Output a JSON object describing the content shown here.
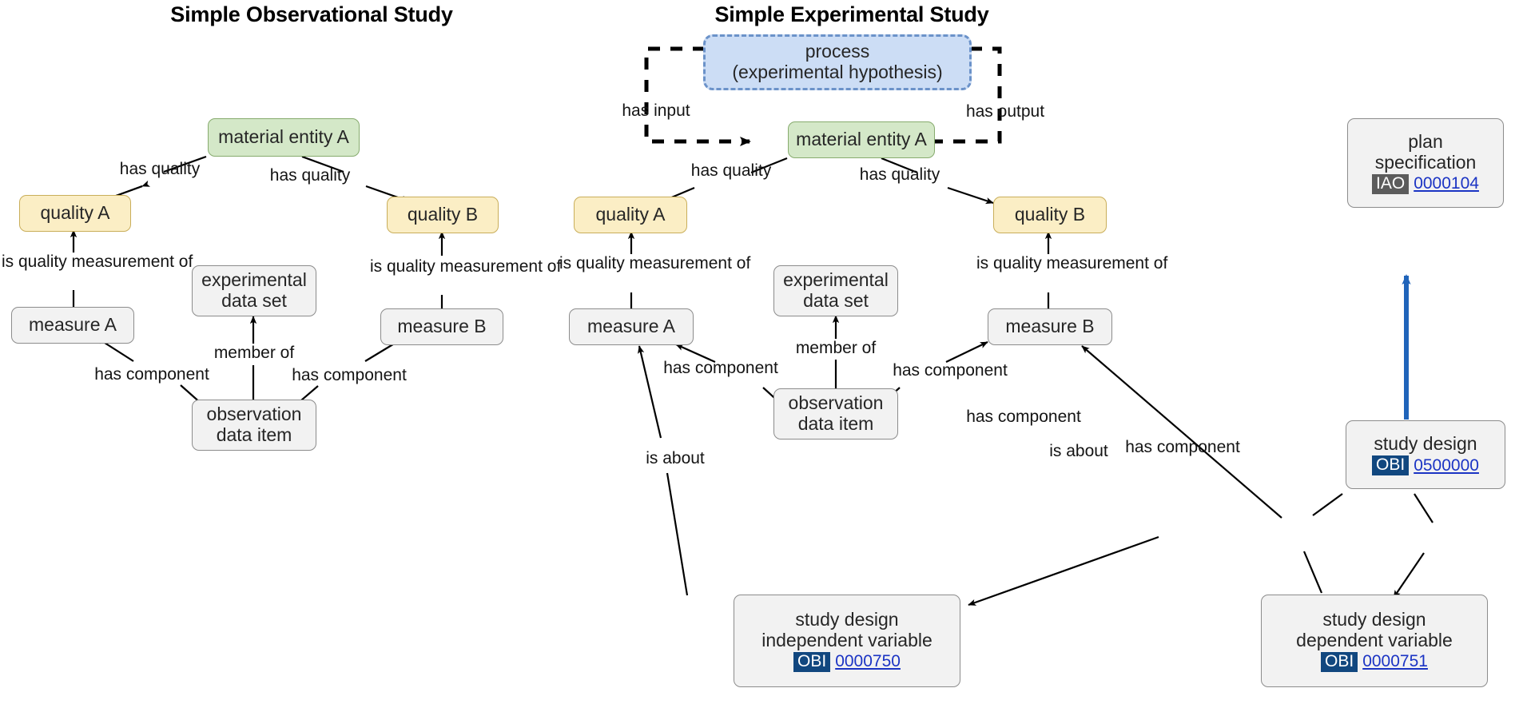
{
  "panels": [
    {
      "title": "Simple Observational Study"
    },
    {
      "title": "Simple Experimental Study"
    }
  ],
  "colors": {
    "material_entity_fill": "#d4e8c8",
    "material_entity_border": "#87ab6e",
    "quality_fill": "#fbeec5",
    "quality_border": "#c9ae5a",
    "process_fill": "#ccddf5",
    "process_border": "#6b92c9",
    "default_fill": "#f2f2f2",
    "default_border": "#8c8c8c",
    "obi_badge": "#11477f",
    "iao_badge": "#5c5c5c",
    "id_link": "#1b34c4",
    "subclass_arrow": "#2064ba"
  },
  "left": {
    "nodes": {
      "material_entity_a": {
        "line1": "material entity A"
      },
      "quality_a": {
        "line1": "quality A"
      },
      "quality_b": {
        "line1": "quality B"
      },
      "measure_a": {
        "line1": "measure A"
      },
      "measure_b": {
        "line1": "measure B"
      },
      "experimental_data_set": {
        "line1": "experimental",
        "line2": "data set"
      },
      "observation_data_item": {
        "line1": "observation",
        "line2": "data item"
      }
    },
    "labels": {
      "has_quality_left": "has quality",
      "has_quality_right": "has quality",
      "is_quality_measurement_of_left_l1": "is quality",
      "is_quality_measurement_of_left_l2": "measurement of",
      "is_quality_measurement_of_right_l1": "is quality",
      "is_quality_measurement_of_right_l2": "measurement of",
      "has_component_left": "has component",
      "has_component_right": "has component",
      "member_of": "member of"
    }
  },
  "right": {
    "nodes": {
      "process": {
        "line1": "process",
        "line2": "(experimental hypothesis)"
      },
      "material_entity_a": {
        "line1": "material entity A"
      },
      "quality_a": {
        "line1": "quality A"
      },
      "quality_b": {
        "line1": "quality B"
      },
      "measure_a": {
        "line1": "measure A"
      },
      "measure_b": {
        "line1": "measure B"
      },
      "experimental_data_set": {
        "line1": "experimental",
        "line2": "data set"
      },
      "observation_data_item": {
        "line1": "observation",
        "line2": "data item"
      },
      "plan_specification": {
        "line1": "plan",
        "line2": "specification",
        "ontology": "IAO",
        "id": "0000104"
      },
      "study_design": {
        "line1": "study design",
        "ontology": "OBI",
        "id": "0500000"
      },
      "study_design_independent_variable": {
        "line1": "study design",
        "line2": "independent variable",
        "ontology": "OBI",
        "id": "0000750"
      },
      "study_design_dependent_variable": {
        "line1": "study design",
        "line2": "dependent variable",
        "ontology": "OBI",
        "id": "0000751"
      }
    },
    "labels": {
      "has_input": "has input",
      "has_output": "has output",
      "has_quality_left": "has quality",
      "has_quality_right": "has quality",
      "is_quality_measurement_of_left_l1": "is quality",
      "is_quality_measurement_of_left_l2": "measurement of",
      "is_quality_measurement_of_right_l1": "is quality",
      "is_quality_measurement_of_right_l2": "measurement of",
      "has_component_left": "has component",
      "has_component_right": "has component",
      "member_of": "member of",
      "is_about_left": "is about",
      "is_about_right": "is about",
      "has_component_iv": "has component",
      "has_component_dv": "has component"
    }
  }
}
